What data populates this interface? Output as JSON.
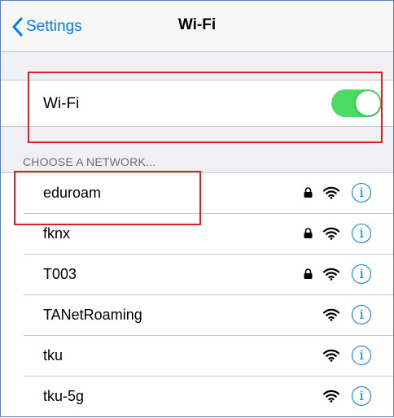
{
  "nav": {
    "back_label": "Settings",
    "title": "Wi-Fi"
  },
  "wifi": {
    "label": "Wi-Fi",
    "enabled": true,
    "toggle_color": "#4cd964"
  },
  "section_header": "CHOOSE A NETWORK...",
  "networks": [
    {
      "name": "eduroam",
      "secured": true
    },
    {
      "name": "fknx",
      "secured": true
    },
    {
      "name": "T003",
      "secured": true
    },
    {
      "name": "TANetRoaming",
      "secured": false
    },
    {
      "name": "tku",
      "secured": false
    },
    {
      "name": "tku-5g",
      "secured": false
    }
  ],
  "info_glyph": "i",
  "colors": {
    "accent": "#007aff",
    "highlight": "#e02020"
  }
}
